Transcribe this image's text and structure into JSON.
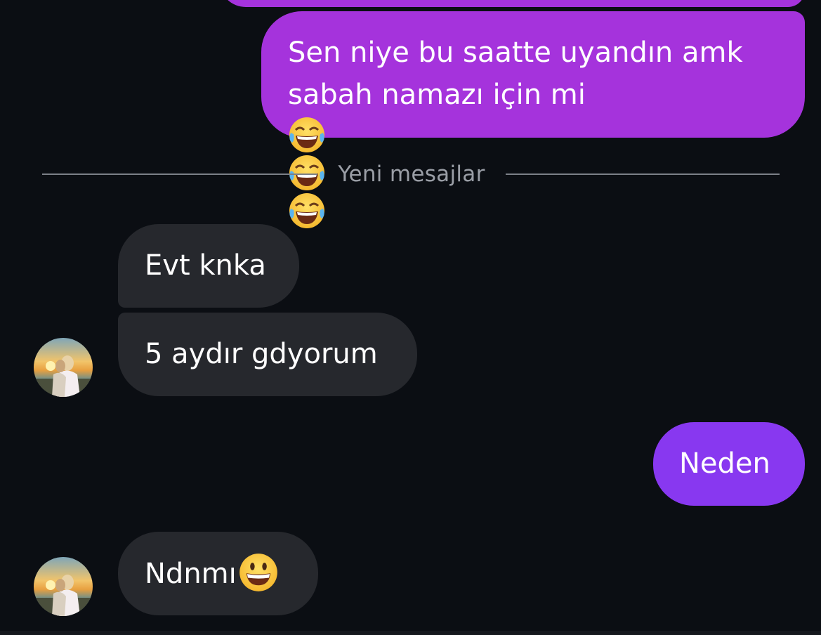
{
  "conversation": {
    "messages": [
      {
        "direction": "outgoing",
        "lines": [
          "Sen niye bu saatte uyandın amk",
          "sabah namazı için mi"
        ],
        "emoji": [
          "face-with-tears-of-joy",
          "face-with-tears-of-joy",
          "face-with-tears-of-joy"
        ]
      },
      {
        "direction": "incoming",
        "text": "Evt knka"
      },
      {
        "direction": "incoming",
        "text": "5 aydır gdyorum"
      },
      {
        "direction": "outgoing",
        "text": "Neden"
      },
      {
        "direction": "incoming",
        "text": "Ndnmı",
        "emoji": [
          "grinning-face"
        ]
      }
    ]
  },
  "divider": {
    "label": "Yeni mesajlar"
  },
  "colors": {
    "background": "#0b0e13",
    "outgoing_bubble": "#a533dc",
    "outgoing_bubble_latest": "#8838f0",
    "incoming_bubble": "#26282d",
    "divider_line": "#7c8088",
    "divider_text": "#9a9ea6"
  }
}
